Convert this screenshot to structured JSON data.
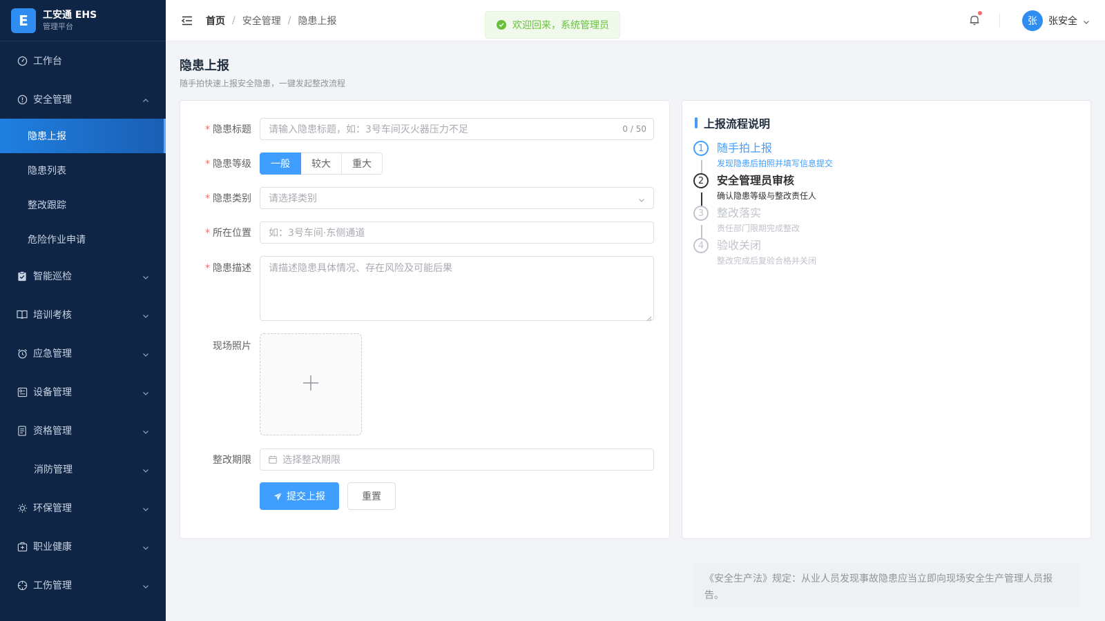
{
  "brand": {
    "logo_letter": "E",
    "name": "工安通 EHS",
    "subtitle": "管理平台"
  },
  "sidebar": {
    "items": [
      {
        "label": "工作台",
        "icon": "dashboard-icon"
      },
      {
        "label": "安全管理",
        "icon": "alert-circle-icon",
        "expanded": true,
        "children": [
          "隐患上报",
          "隐患列表",
          "整改跟踪",
          "危险作业申请"
        ],
        "active_child": "隐患上报"
      },
      {
        "label": "智能巡检",
        "icon": "clipboard-check-icon"
      },
      {
        "label": "培训考核",
        "icon": "book-icon"
      },
      {
        "label": "应急管理",
        "icon": "alarm-clock-icon"
      },
      {
        "label": "设备管理",
        "icon": "device-icon"
      },
      {
        "label": "资格管理",
        "icon": "document-icon"
      },
      {
        "label": "消防管理",
        "icon": ""
      },
      {
        "label": "环保管理",
        "icon": "sun-icon"
      },
      {
        "label": "职业健康",
        "icon": "medical-kit-icon"
      },
      {
        "label": "工伤管理",
        "icon": "aim-icon"
      }
    ]
  },
  "header": {
    "breadcrumb": [
      "首页",
      "安全管理",
      "隐患上报"
    ],
    "toast": "欢迎回来，系统管理员",
    "user": {
      "avatar_char": "张",
      "name": "张安全"
    }
  },
  "page": {
    "title": "隐患上报",
    "subtitle": "随手拍快速上报安全隐患，一键发起整改流程"
  },
  "form": {
    "title_label": "隐患标题",
    "title_placeholder": "请输入隐患标题，如：3号车间灭火器压力不足",
    "title_count": "0 / 50",
    "level_label": "隐患等级",
    "levels": [
      "一般",
      "较大",
      "重大"
    ],
    "level_selected": "一般",
    "category_label": "隐患类别",
    "category_placeholder": "请选择类别",
    "location_label": "所在位置",
    "location_placeholder": "如：3号车间·东侧通道",
    "desc_label": "隐患描述",
    "desc_placeholder": "请描述隐患具体情况、存在风险及可能后果",
    "photo_label": "现场照片",
    "deadline_label": "整改期限",
    "deadline_placeholder": "选择整改期限",
    "submit_label": "提交上报",
    "reset_label": "重置"
  },
  "flow": {
    "title": "上报流程说明",
    "steps": [
      {
        "num": "1",
        "title": "随手拍上报",
        "desc": "发现隐患后拍照并填写信息提交",
        "status": "done"
      },
      {
        "num": "2",
        "title": "安全管理员审核",
        "desc": "确认隐患等级与整改责任人",
        "status": "current"
      },
      {
        "num": "3",
        "title": "整改落实",
        "desc": "责任部门限期完成整改",
        "status": "pending"
      },
      {
        "num": "4",
        "title": "验收关闭",
        "desc": "整改完成后复验合格并关闭",
        "status": "pending"
      }
    ]
  },
  "law_note": "《安全生产法》规定：从业人员发现事故隐患应当立即向现场安全生产管理人员报告。",
  "colors": {
    "sidebar_bg": "#0f2545",
    "primary": "#409eff",
    "active_menu": "#1f7fe0",
    "success": "#67c23a",
    "danger": "#f56c6c"
  }
}
